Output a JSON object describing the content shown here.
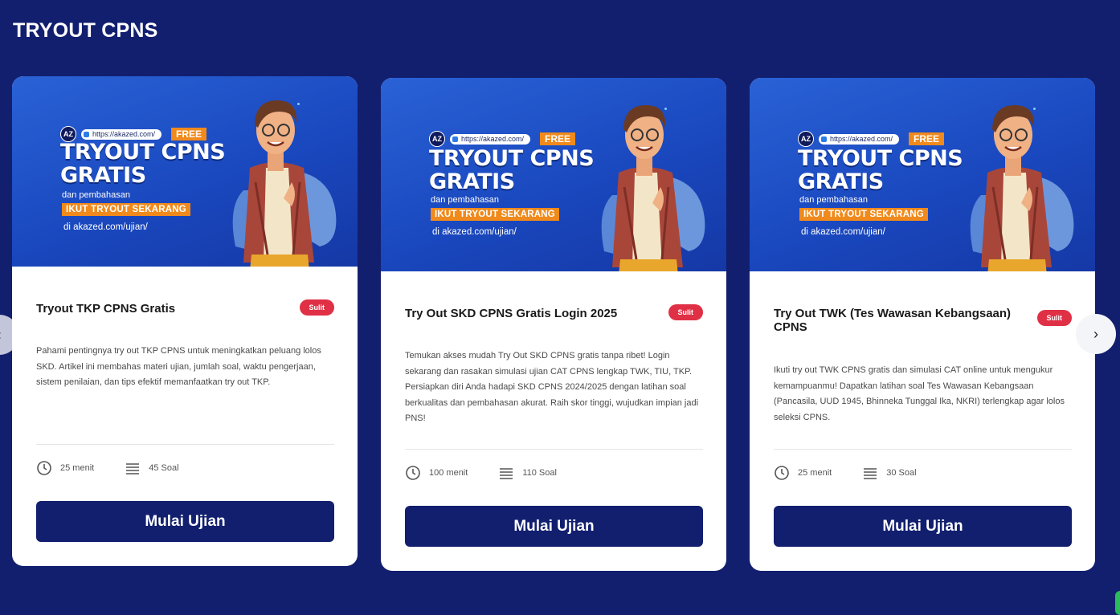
{
  "section": {
    "title": "TRYOUT CPNS"
  },
  "banner": {
    "url": "https://akazed.com/",
    "free": "FREE",
    "headline_1": "TRYOUT CPNS",
    "headline_2": "GRATIS",
    "sub": "dan pembahasan",
    "cta": "IKUT TRYOUT SEKARANG",
    "link": "di akazed.com/ujian/",
    "logo": "AZ"
  },
  "cards": [
    {
      "title": "Tryout TKP CPNS Gratis",
      "level": "Sulit",
      "description": "Pahami pentingnya try out TKP CPNS untuk meningkatkan peluang lolos SKD. Artikel ini membahas materi ujian, jumlah soal, waktu pengerjaan, sistem penilaian, dan tips efektif memanfaatkan try out TKP.",
      "duration": "25 menit",
      "questions": "45 Soal",
      "button": "Mulai Ujian"
    },
    {
      "title": "Try Out SKD CPNS Gratis Login 2025",
      "level": "Sulit",
      "description": "Temukan akses mudah Try Out SKD CPNS gratis tanpa ribet! Login sekarang dan rasakan simulasi ujian CAT CPNS lengkap TWK, TIU, TKP. Persiapkan diri Anda hadapi SKD CPNS 2024/2025 dengan latihan soal berkualitas dan pembahasan akurat. Raih skor tinggi, wujudkan impian jadi PNS!",
      "duration": "100 menit",
      "questions": "110 Soal",
      "button": "Mulai Ujian"
    },
    {
      "title": "Try Out TWK (Tes Wawasan Kebangsaan) CPNS",
      "level": "Sulit",
      "description": "Ikuti try out TWK CPNS gratis dan simulasi CAT online untuk mengukur kemampuanmu! Dapatkan latihan soal Tes Wawasan Kebangsaan (Pancasila, UUD 1945, Bhinneka Tunggal Ika, NKRI) terlengkap agar lolos seleksi CPNS.",
      "duration": "25 menit",
      "questions": "30 Soal",
      "button": "Mulai Ujian"
    }
  ],
  "nav": {
    "prev": "‹",
    "next": "›"
  },
  "colors": {
    "background": "#121f6f",
    "badge": "#e03046",
    "button": "#121f6f",
    "accent": "#f08a1c"
  },
  "icons": {
    "duration": "clock-icon",
    "questions": "list-icon"
  }
}
